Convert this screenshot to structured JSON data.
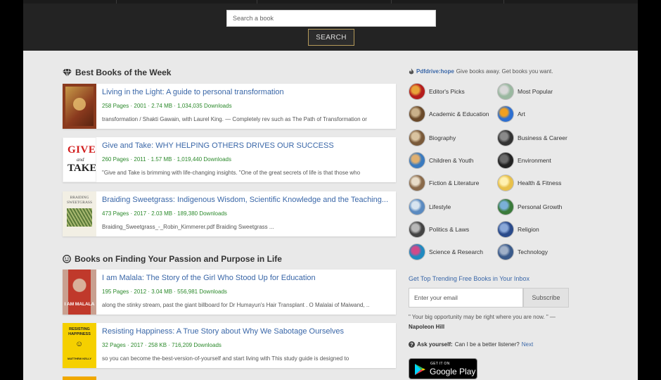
{
  "search": {
    "placeholder": "Search a book",
    "button_label": "SEARCH"
  },
  "sections": [
    {
      "title": "Best Books of the Week",
      "icon": "diamond-icon",
      "books": [
        {
          "title": "Living in the Light: A guide to personal transformation",
          "meta": "258 Pages · 2001 · 2.74 MB · 1,034,035 Downloads",
          "desc": "transformation / Shakti Gawain, with Laurel King. — Completely rev such as The Path of Transformation or",
          "cover_colors": [
            "#8a3a1e",
            "#c79a48"
          ]
        },
        {
          "title": "Give and Take: WHY HELPING OTHERS DRIVES OUR SUCCESS",
          "meta": "260 Pages · 2011 · 1.57 MB · 1,019,440 Downloads",
          "desc": "\"Give and Take is brimming with life-changing insights. \"One of the great secrets of life is that those who",
          "cover_text": [
            "GIVE",
            "and",
            "TAKE."
          ],
          "cover_colors": [
            "#d11c1c",
            "#222222"
          ]
        },
        {
          "title": "Braiding Sweetgrass: Indigenous Wisdom, Scientific Knowledge and the Teaching...",
          "meta": "473 Pages · 2017 · 2.03 MB · 189,380 Downloads",
          "desc": "Braiding_Sweetgrass_-_Robin_Kimmerer.pdf Braiding Sweetgrass  ...",
          "cover_text": [
            "BRAIDING",
            "SWEETGRASS"
          ],
          "cover_colors": [
            "#f2efe4",
            "#5a7a3a"
          ]
        }
      ]
    },
    {
      "title": "Books on Finding Your Passion and Purpose in Life",
      "icon": "smiley-icon",
      "books": [
        {
          "title": "I am Malala: The Story of the Girl Who Stood Up for Education",
          "meta": "195 Pages · 2012 · 3.04 MB · 556,981 Downloads",
          "desc": "along the stinky stream, past the giant billboard for Dr Humayun's Hair Transplant . O Malalai of Maiwand, ..",
          "cover_text": [
            "I AM MALALA"
          ],
          "cover_colors": [
            "#c0392b",
            "#7a1f1f"
          ]
        },
        {
          "title": "Resisting Happiness: A True Story about Why We Sabotage Ourselves",
          "meta": "32 Pages · 2017 · 258 KB · 716,209 Downloads",
          "desc": "so you can become the-best-version-of-yourself and start living with This study guide is designed to",
          "cover_text": [
            "RESISTING",
            "HAPPINESS",
            "MATTHEW KELLY"
          ],
          "cover_colors": [
            "#f5d000",
            "#222222"
          ]
        }
      ]
    }
  ],
  "sidebar": {
    "brand": "Pdfdrive:hope",
    "intro": "Give books away. Get books you want.",
    "categories": [
      {
        "label": "Editor's Picks",
        "icon": "editors-picks-icon",
        "colors": [
          "#b51d1d",
          "#e8a33a"
        ]
      },
      {
        "label": "Most Popular",
        "icon": "most-popular-icon",
        "colors": [
          "#9ab8a0",
          "#d8d8d8"
        ]
      },
      {
        "label": "Academic & Education",
        "icon": "academic-icon",
        "colors": [
          "#6b4a2a",
          "#c9b08a"
        ]
      },
      {
        "label": "Art",
        "icon": "art-icon",
        "colors": [
          "#2d6fd1",
          "#f0a020"
        ]
      },
      {
        "label": "Biography",
        "icon": "biography-icon",
        "colors": [
          "#7a5a3a",
          "#d9c3a0"
        ]
      },
      {
        "label": "Business & Career",
        "icon": "business-icon",
        "colors": [
          "#333333",
          "#8a8a8a"
        ]
      },
      {
        "label": "Children & Youth",
        "icon": "children-icon",
        "colors": [
          "#3a7abf",
          "#e0b070"
        ]
      },
      {
        "label": "Environment",
        "icon": "environment-icon",
        "colors": [
          "#222222",
          "#6a6a6a"
        ]
      },
      {
        "label": "Fiction & Literature",
        "icon": "fiction-icon",
        "colors": [
          "#8a6a4a",
          "#e8dcc8"
        ]
      },
      {
        "label": "Health & Fitness",
        "icon": "health-icon",
        "colors": [
          "#e8c04a",
          "#fff1b0"
        ]
      },
      {
        "label": "Lifestyle",
        "icon": "lifestyle-icon",
        "colors": [
          "#5a8ac0",
          "#d8e4f0"
        ]
      },
      {
        "label": "Personal Growth",
        "icon": "personal-growth-icon",
        "colors": [
          "#3a7a3a",
          "#7ab0d8"
        ]
      },
      {
        "label": "Politics & Laws",
        "icon": "politics-icon",
        "colors": [
          "#444444",
          "#b8b8b8"
        ]
      },
      {
        "label": "Religion",
        "icon": "religion-icon",
        "colors": [
          "#2a4a8a",
          "#8aa8d8"
        ]
      },
      {
        "label": "Science & Research",
        "icon": "science-icon",
        "colors": [
          "#1f8ac0",
          "#d04a8a"
        ]
      },
      {
        "label": "Technology",
        "icon": "technology-icon",
        "colors": [
          "#3a5a8a",
          "#a0b0c8"
        ]
      }
    ],
    "inbox_title": "Get Top Trending Free Books in Your Inbox",
    "email_placeholder": "Enter your email",
    "subscribe_label": "Subscribe",
    "quote": "\" Your big opportunity may be right where you are now. \" —",
    "author": "Napoleon Hill",
    "ask_prefix": "Ask yourself:",
    "ask_text": "Can I be a better listener?",
    "ask_next": "Next",
    "gplay_small": "GET IT ON",
    "gplay_big": "Google Play"
  },
  "colors": {
    "link": "#3a67a8",
    "meta": "#2c8a2c",
    "header_bg": "#232323",
    "button_border": "#b59a5a"
  }
}
